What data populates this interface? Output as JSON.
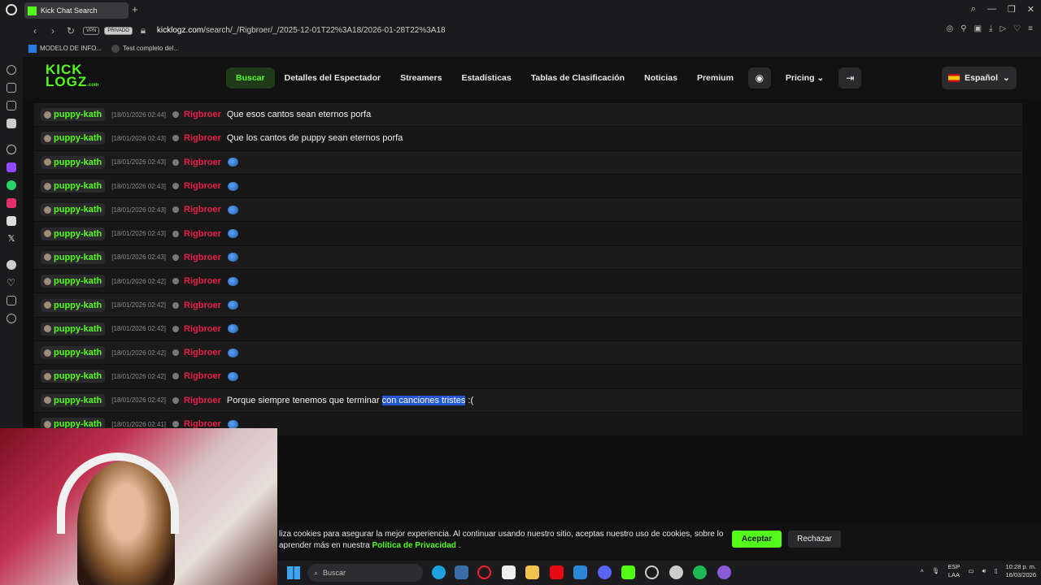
{
  "browser": {
    "tab_title": "Kick Chat Search",
    "new_tab_label": "+",
    "vpn_label": "VPN",
    "private_label": "PRIVADO",
    "url_host": "kicklogz.com",
    "url_path": "/search/_/Rigbroer/_/2025-12-01T22%3A18/2026-01-28T22%3A18",
    "bookmarks": [
      "MODELO DE INFO...",
      "Test completo del..."
    ]
  },
  "site": {
    "logo_line1": "KICK",
    "logo_line2": "LOGZ",
    "logo_suffix": ".com",
    "nav": [
      "Buscar",
      "Detalles del Espectador",
      "Streamers",
      "Estadísticas",
      "Tablas de Clasificación",
      "Noticias",
      "Premium"
    ],
    "pricing_label": "Pricing",
    "language_label": "Español"
  },
  "chat": {
    "rows": [
      {
        "user": "puppy-kath",
        "time": "[18/01/2026 02:44]",
        "target": "Rigbroer",
        "msg": "Que esos cantos sean eternos porfa"
      },
      {
        "user": "puppy-kath",
        "time": "[18/01/2026 02:43]",
        "target": "Rigbroer",
        "msg": "Que los cantos de puppy sean eternos porfa"
      },
      {
        "user": "puppy-kath",
        "time": "[18/01/2026 02:43]",
        "target": "Rigbroer",
        "msg": ""
      },
      {
        "user": "puppy-kath",
        "time": "[18/01/2026 02:43]",
        "target": "Rigbroer",
        "msg": ""
      },
      {
        "user": "puppy-kath",
        "time": "[18/01/2026 02:43]",
        "target": "Rigbroer",
        "msg": ""
      },
      {
        "user": "puppy-kath",
        "time": "[18/01/2026 02:43]",
        "target": "Rigbroer",
        "msg": ""
      },
      {
        "user": "puppy-kath",
        "time": "[18/01/2026 02:43]",
        "target": "Rigbroer",
        "msg": ""
      },
      {
        "user": "puppy-kath",
        "time": "[18/01/2026 02:42]",
        "target": "Rigbroer",
        "msg": ""
      },
      {
        "user": "puppy-kath",
        "time": "[18/01/2026 02:42]",
        "target": "Rigbroer",
        "msg": ""
      },
      {
        "user": "puppy-kath",
        "time": "[18/01/2026 02:42]",
        "target": "Rigbroer",
        "msg": ""
      },
      {
        "user": "puppy-kath",
        "time": "[18/01/2026 02:42]",
        "target": "Rigbroer",
        "msg": ""
      },
      {
        "user": "puppy-kath",
        "time": "[18/01/2026 02:42]",
        "target": "Rigbroer",
        "msg": ""
      },
      {
        "user": "puppy-kath",
        "time": "[18/01/2026 02:42]",
        "target": "Rigbroer",
        "msg_before": "Porque siempre tenemos que terminar ",
        "msg_selected": "con canciones tristes",
        "msg_after": " :("
      },
      {
        "user": "puppy-kath",
        "time": "[18/01/2026 02:41]",
        "target": "Rigbroer",
        "msg": ""
      }
    ]
  },
  "cookie_banner": {
    "text_line1": "liza cookies para asegurar la mejor experiencia. Al continuar usando nuestro sitio, aceptas nuestro uso de cookies, sobre lo",
    "text_line2_prefix": "aprender más en nuestra ",
    "link": "Política de Privacidad",
    "text_line2_suffix": " .",
    "accept": "Aceptar",
    "reject": "Rechazar"
  },
  "taskbar": {
    "search_placeholder": "Buscar",
    "lang_top": "ESP",
    "lang_bottom": "LAA",
    "time": "10:28 p. m.",
    "date": "16/03/2026"
  },
  "colors": {
    "accent": "#53fc18",
    "target": "#e91f4a",
    "selection": "#2456d6"
  }
}
